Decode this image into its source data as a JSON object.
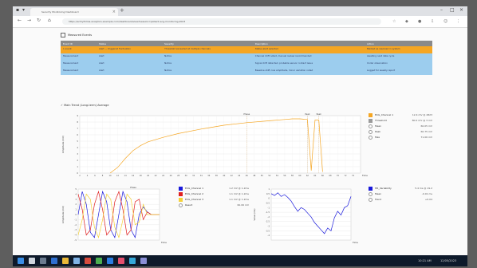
{
  "browser": {
    "tab_title": "Security Monitoring Dashboard",
    "url": "https://arrhythmia.analytics.example.com/dashboard/view?session=patient-ecg-monitoring-2023"
  },
  "section": {
    "title": "Measured Events"
  },
  "table": {
    "headers": [
      "Event ID",
      "Status",
      "Severity",
      "Description",
      "Action"
    ],
    "rows": [
      [
        "1 event",
        "Alert — triggered fluctuation",
        "Threshold exceeded at multiple channels",
        "Status alert selected",
        "Marked as resolved in system"
      ],
      [
        "Measurement",
        "Alert",
        "Notice",
        "Channel drift noted, manual review recommended",
        "Awaiting next data cycle"
      ],
      [
        "Measurement",
        "Alert",
        "Notice",
        "Signal drift detected, probable sensor contact issue",
        "Under observation"
      ],
      [
        "Measurement",
        "Alert",
        "Notice",
        "Baseline shift, low amplitude, minor variation noted",
        "Logged for weekly report"
      ]
    ]
  },
  "main_chart": {
    "title": "Main Trend (Long-term) Average",
    "chart_data": {
      "type": "line",
      "x": [
        10,
        12,
        14,
        16,
        18,
        20,
        24,
        28,
        34,
        40,
        46,
        52,
        56,
        58,
        60,
        62,
        63,
        64,
        65,
        66
      ],
      "series": [
        {
          "name": "ECG_Channel 1",
          "values": [
            0,
            0.9,
            2.3,
            3.5,
            4.3,
            4.9,
            5.6,
            6.2,
            6.9,
            7.5,
            7.9,
            8.2,
            8.4,
            8.5,
            8.5,
            8.4,
            0.4,
            8.3,
            8.3,
            0.2
          ]
        }
      ],
      "ylim": [
        0,
        9
      ],
      "xlim": [
        2,
        76
      ],
      "x_ticks": [
        2,
        4,
        6,
        8,
        10,
        12,
        14,
        16,
        18,
        20,
        22,
        24,
        26,
        28,
        30,
        32,
        34,
        36,
        38,
        40,
        42,
        44,
        46,
        48,
        50,
        52,
        54,
        56,
        58,
        60,
        62,
        64,
        66,
        68,
        70,
        72,
        74
      ],
      "y_ticks": [
        0,
        1,
        2,
        3,
        4,
        5,
        6,
        7,
        8,
        9
      ],
      "markers": [
        {
          "x": 46,
          "label": "Phase"
        },
        {
          "x": 62,
          "label": "Peak"
        },
        {
          "x": 65,
          "label": "Peak"
        }
      ],
      "xlabel": "Time",
      "ylabel": "Amplitude (mV)",
      "grid": true
    },
    "legend": [
      {
        "name": "ECG_Channel 1",
        "value": "12.4 mV @ 2823",
        "color": "#f5a623",
        "kind": "swatch"
      },
      {
        "name": "Threshold",
        "value": "80.0 mV @ 3 mV",
        "color": "#9b9b9b",
        "kind": "swatch"
      },
      {
        "name": "Mean",
        "value": "60.05 mV",
        "kind": "radio"
      },
      {
        "name": "Peak",
        "value": "60.75 mV",
        "kind": "radio"
      },
      {
        "name": "Max",
        "value": "71.06 mV",
        "kind": "radio"
      }
    ]
  },
  "wave_chart": {
    "title": "Multi-Channel Waveform",
    "chart_data": {
      "type": "line",
      "x": [
        0,
        1,
        2,
        3,
        4,
        5,
        6,
        7,
        8,
        9,
        10,
        11,
        12,
        13,
        14,
        15,
        16,
        17,
        18,
        19,
        20
      ],
      "series": [
        {
          "name": "ECG_Channel 1",
          "values": [
            0,
            4.5,
            2,
            -3.5,
            -4.5,
            0,
            4.5,
            2.5,
            -3,
            -4.5,
            0,
            4.5,
            2.5,
            -3,
            -4.5,
            0,
            1.5,
            0.5,
            0,
            0,
            0
          ]
        },
        {
          "name": "ECG_Channel 2",
          "values": [
            4,
            1,
            -4,
            -3,
            2,
            4.5,
            1,
            -4,
            -3,
            2.5,
            4.5,
            1,
            -4,
            -3,
            2.5,
            3,
            -1,
            0.5,
            0,
            0,
            0
          ]
        },
        {
          "name": "ECG_Channel 3",
          "values": [
            -4,
            -1,
            4,
            3,
            -2.5,
            -4.5,
            -1,
            4,
            3,
            -2.5,
            -4.5,
            -1,
            4,
            3,
            -2,
            -1.5,
            2,
            0,
            0,
            0,
            0
          ]
        }
      ],
      "ylim": [
        -5,
        5
      ],
      "y_ticks": [
        -5,
        -4,
        -3,
        -2,
        -1,
        0,
        1,
        2,
        3,
        4,
        5
      ],
      "marker_label": "Phase",
      "xlabel": "Time",
      "ylabel": "Amplitude (mV)"
    },
    "legend": [
      {
        "name": "ECG_Channel 1",
        "value": "1.2 mV @ 1.2ms",
        "color": "#1a1adb",
        "kind": "swatch"
      },
      {
        "name": "ECG_Channel 2",
        "value": "1.1 mV @ 1.2ms",
        "color": "#e02020",
        "kind": "swatch"
      },
      {
        "name": "ECG_Channel 3",
        "value": "1.1 mV @ 1.2ms",
        "color": "#f5d23a",
        "kind": "swatch"
      },
      {
        "name": "Result",
        "value": "60.06 mV",
        "kind": "radio"
      }
    ]
  },
  "var_chart": {
    "title": "Variability",
    "chart_data": {
      "type": "line",
      "x": [
        0,
        1,
        2,
        3,
        4,
        5,
        6,
        7,
        8,
        9,
        10,
        11,
        12,
        13,
        14,
        15,
        16,
        17,
        18,
        19,
        20,
        21,
        22,
        23,
        24
      ],
      "series": [
        {
          "name": "HR_Variability",
          "values": [
            0.5,
            0.3,
            0.6,
            0.2,
            0.4,
            0.1,
            -0.3,
            -0.9,
            -1.4,
            -1.0,
            -1.2,
            -1.6,
            -2.0,
            -2.6,
            -3.0,
            -3.4,
            -3.8,
            -3.2,
            -3.5,
            -2.1,
            -1.4,
            -1.8,
            -1.0,
            -0.8,
            0.2
          ]
        }
      ],
      "ylim": [
        -4.5,
        1
      ],
      "y_ticks": [
        1,
        0.5,
        0,
        -0.5,
        -1,
        -1.5,
        -2,
        -2.5,
        -3,
        -3.5,
        -4
      ],
      "xlabel": "Time",
      "ylabel": "Value (ms)"
    },
    "legend": [
      {
        "name": "HR_Variability",
        "value": "5.4 ms @ 19.2",
        "color": "#1a1adb",
        "kind": "swatch"
      },
      {
        "name": "Mean",
        "value": "-0.01 ms",
        "kind": "radio"
      },
      {
        "name": "Trend",
        "value": "+0.04",
        "kind": "radio"
      }
    ]
  },
  "taskbar": {
    "time": "10:21 AM",
    "date": "12/05/2023"
  }
}
